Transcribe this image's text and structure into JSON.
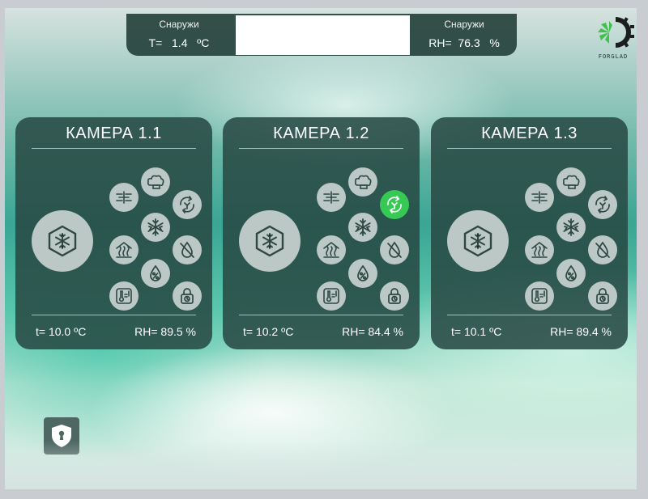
{
  "outside": {
    "temp_label": "Снаружи",
    "temp_prefix": "T=",
    "temp_value": "1.4",
    "temp_unit": "ºC",
    "rh_label": "Снаружи",
    "rh_prefix": "RH=",
    "rh_value": "76.3",
    "rh_unit": "%"
  },
  "logo": {
    "text": "FORGLAD"
  },
  "cameras": [
    {
      "title": "КАМЕРА 1.1",
      "temp": "t= 10.0  ºC",
      "rh": "RH= 89.5  %",
      "active_mode": ""
    },
    {
      "title": "КАМЕРА 1.2",
      "temp": "t= 10.2  ºC",
      "rh": "RH= 84.4  %",
      "active_mode": "recirculation"
    },
    {
      "title": "КАМЕРА 1.3",
      "temp": "t= 10.1  ºC",
      "rh": "RH= 89.4  %",
      "active_mode": ""
    }
  ],
  "icons": {
    "main": "freeze-cube-icon",
    "modes": [
      "steam-icon",
      "recirculation-icon",
      "fan-icon",
      "snowflake-icon",
      "heating-icon",
      "no-humidity-icon",
      "humidity-icon",
      "thermometer-icon",
      "lock-timer-icon"
    ],
    "security": "shield-lock-icon"
  },
  "colors": {
    "card_bg": "#284a44",
    "icon_bg": "#bcc8c5",
    "active": "#36c954",
    "icon_stroke": "#2f4844"
  }
}
